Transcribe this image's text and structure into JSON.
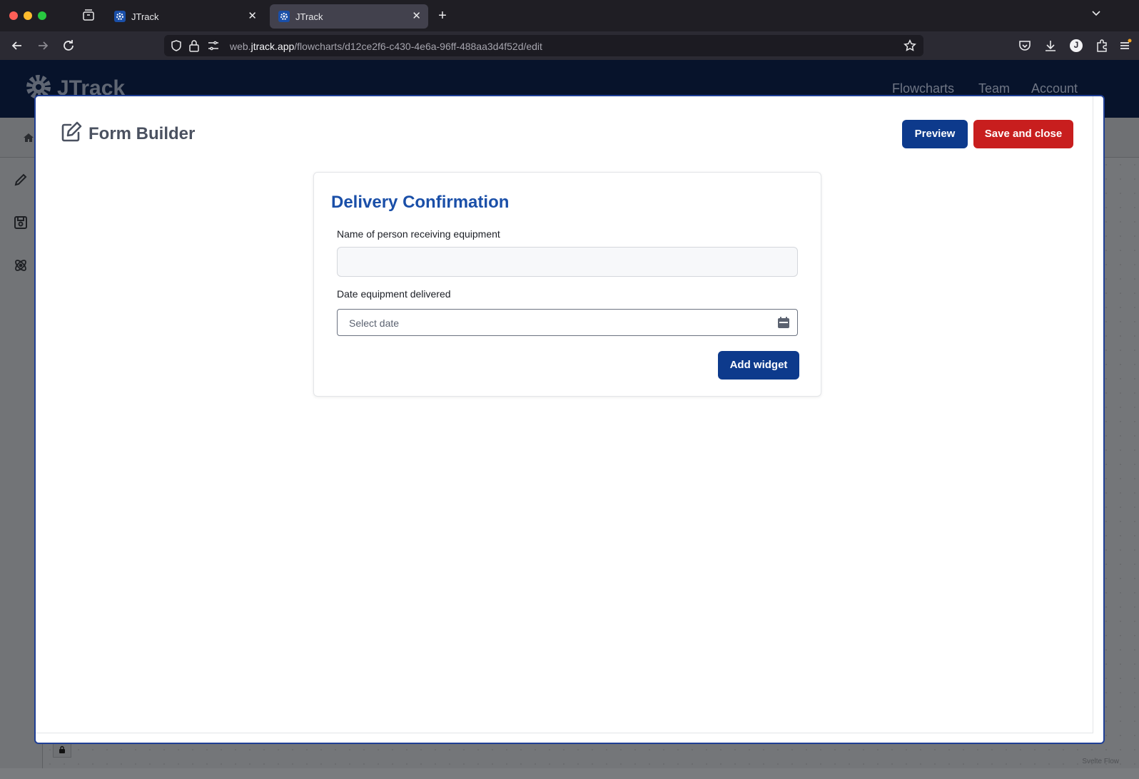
{
  "browser": {
    "tabs": [
      {
        "title": "JTrack",
        "active": false
      },
      {
        "title": "JTrack",
        "active": true
      }
    ],
    "url_prefix": "web.",
    "url_domain": "jtrack.app",
    "url_path": "/flowcharts/d12ce2f6-c430-4e6a-96ff-488aa3d4f52d/edit",
    "profile_initial": "J"
  },
  "app": {
    "logo_text": "JTrack",
    "nav": [
      "Flowcharts",
      "Team",
      "Account"
    ],
    "attribution": "Svelte Flow"
  },
  "modal": {
    "title": "Form Builder",
    "preview_label": "Preview",
    "save_label": "Save and close"
  },
  "form": {
    "title": "Delivery Confirmation",
    "fields": [
      {
        "label": "Name of person receiving equipment",
        "type": "text",
        "value": "",
        "placeholder": ""
      },
      {
        "label": "Date equipment delivered",
        "type": "date",
        "value": "",
        "placeholder": "Select date"
      }
    ],
    "add_widget_label": "Add widget"
  },
  "colors": {
    "primary": "#0d3a8c",
    "danger": "#c81e1e",
    "title_blue": "#1a4fa8",
    "header_bg": "#07132b"
  }
}
